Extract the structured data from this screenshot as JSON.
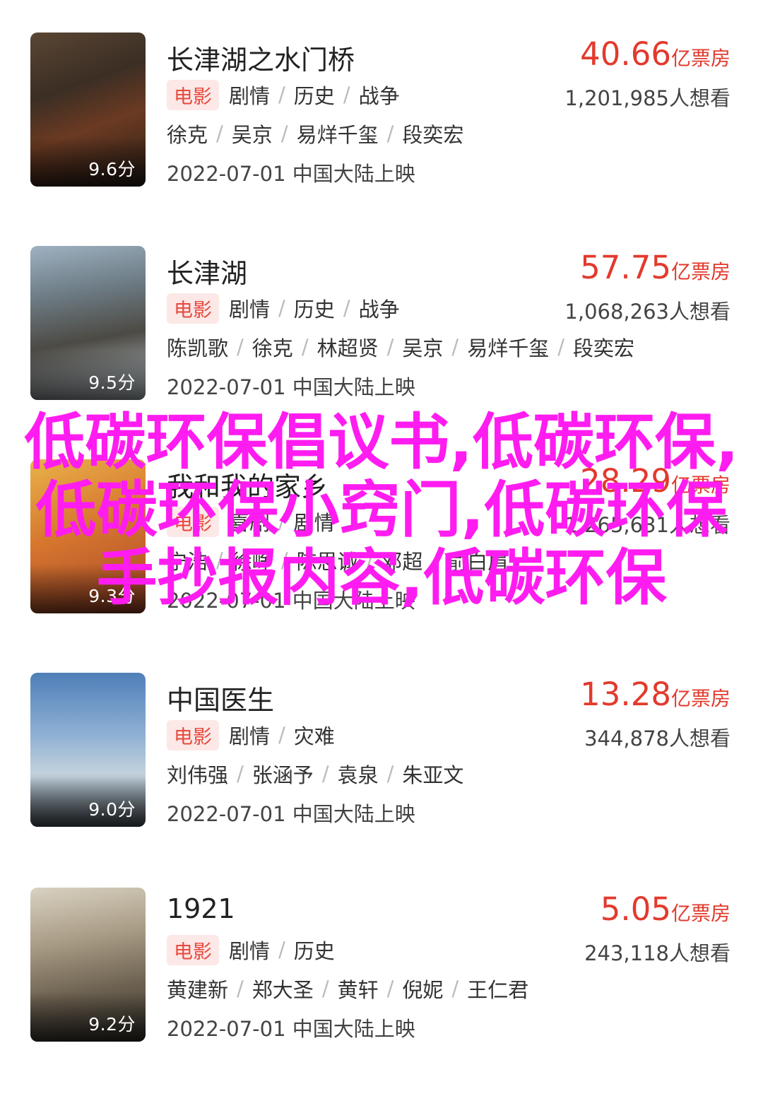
{
  "overlay_text": "低碳环保倡议书,低碳环保,低碳环保小窍门,低碳环保手抄报内容,低碳环保",
  "movies": [
    {
      "title": "长津湖之水门桥",
      "box_number": "40.66",
      "box_unit": "亿票房",
      "score": "9.6分",
      "tag": "电影",
      "genres": [
        "剧情",
        "历史",
        "战争"
      ],
      "want": "1,201,985人想看",
      "cast": [
        "徐克",
        "吴京",
        "易烊千玺",
        "段奕宏"
      ],
      "release": "2022-07-01 中国大陆上映"
    },
    {
      "title": "长津湖",
      "box_number": "57.75",
      "box_unit": "亿票房",
      "score": "9.5分",
      "tag": "电影",
      "genres": [
        "剧情",
        "历史",
        "战争"
      ],
      "want": "1,068,263人想看",
      "cast": [
        "陈凯歌",
        "徐克",
        "林超贤",
        "吴京",
        "易烊千玺",
        "段奕宏"
      ],
      "release": "2022-07-01 中国大陆上映"
    },
    {
      "title": "我和我的家乡",
      "box_number": "28.29",
      "box_unit": "亿票房",
      "score": "9.3分",
      "tag": "电影",
      "genres": [
        "喜剧",
        "剧情"
      ],
      "want": "1,265,631人想看",
      "cast": [
        "宁浩",
        "徐峥",
        "陈思诚",
        "邓超",
        "俞白眉"
      ],
      "release": "2022-07-01 中国大陆上映"
    },
    {
      "title": "中国医生",
      "box_number": "13.28",
      "box_unit": "亿票房",
      "score": "9.0分",
      "tag": "电影",
      "genres": [
        "剧情",
        "灾难"
      ],
      "want": "344,878人想看",
      "cast": [
        "刘伟强",
        "张涵予",
        "袁泉",
        "朱亚文"
      ],
      "release": "2022-07-01 中国大陆上映"
    },
    {
      "title": "1921",
      "box_number": "5.05",
      "box_unit": "亿票房",
      "score": "9.2分",
      "tag": "电影",
      "genres": [
        "剧情",
        "历史"
      ],
      "want": "243,118人想看",
      "cast": [
        "黄建新",
        "郑大圣",
        "黄轩",
        "倪妮",
        "王仁君"
      ],
      "release": "2022-07-01 中国大陆上映"
    }
  ],
  "colors": {
    "accent": "#e23a2d",
    "tag_bg": "#fbe8e7",
    "overlay": "#ff1cf0"
  }
}
